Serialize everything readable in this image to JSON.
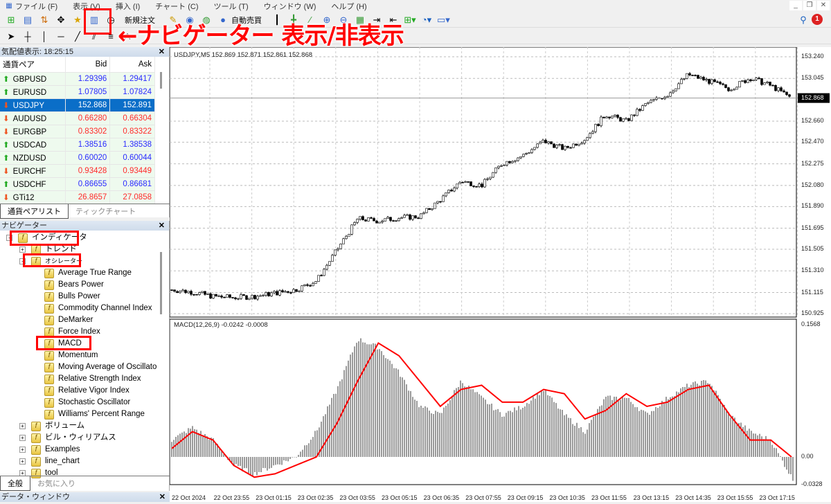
{
  "menu": [
    "ファイル (F)",
    "表示 (V)",
    "挿入 (I)",
    "チャート (C)",
    "ツール (T)",
    "ウィンドウ (W)",
    "ヘルプ (H)"
  ],
  "toolbar": {
    "new_order": "新規注文",
    "auto_trade": "自動売買",
    "notification_count": "1"
  },
  "annotation": {
    "text": "←ナビゲーター 表示/非表示",
    "color": "#ff0000"
  },
  "market_watch": {
    "title": "気配値表示: 18:25:15",
    "columns": [
      "通貨ペア",
      "Bid",
      "Ask"
    ],
    "rows": [
      {
        "symbol": "GBPUSD",
        "bid": "1.29396",
        "ask": "1.29417",
        "dir": "up"
      },
      {
        "symbol": "EURUSD",
        "bid": "1.07805",
        "ask": "1.07824",
        "dir": "up"
      },
      {
        "symbol": "USDJPY",
        "bid": "152.868",
        "ask": "152.891",
        "dir": "down",
        "selected": true
      },
      {
        "symbol": "AUDUSD",
        "bid": "0.66280",
        "ask": "0.66304",
        "dir": "down"
      },
      {
        "symbol": "EURGBP",
        "bid": "0.83302",
        "ask": "0.83322",
        "dir": "down"
      },
      {
        "symbol": "USDCAD",
        "bid": "1.38516",
        "ask": "1.38538",
        "dir": "up"
      },
      {
        "symbol": "NZDUSD",
        "bid": "0.60020",
        "ask": "0.60044",
        "dir": "up"
      },
      {
        "symbol": "EURCHF",
        "bid": "0.93428",
        "ask": "0.93449",
        "dir": "down"
      },
      {
        "symbol": "USDCHF",
        "bid": "0.86655",
        "ask": "0.86681",
        "dir": "up"
      },
      {
        "symbol": "GTi12",
        "bid": "26.8657",
        "ask": "27.0858",
        "dir": "down"
      }
    ],
    "tabs": [
      "通貨ペアリスト",
      "ティックチャート"
    ]
  },
  "navigator": {
    "title": "ナビゲーター",
    "root": "インディケータ",
    "groups": [
      "トレンド",
      "オシレーター"
    ],
    "oscillators": [
      "Average True Range",
      "Bears Power",
      "Bulls Power",
      "Commodity Channel Index",
      "DeMarker",
      "Force Index",
      "MACD",
      "Momentum",
      "Moving Average of Oscillato",
      "Relative Strength Index",
      "Relative Vigor Index",
      "Stochastic Oscillator",
      "Williams' Percent Range"
    ],
    "others": [
      "ボリューム",
      "ビル・ウィリアムス",
      "Examples",
      "line_chart",
      "tool"
    ],
    "tabs": [
      "全般",
      "お気に入り"
    ]
  },
  "data_window": {
    "title": "データ・ウィンドウ"
  },
  "chart_data": [
    {
      "type": "candlestick",
      "title": "USDJPY,M5  152.869 152.871 152.861 152.868",
      "ylim": [
        150.925,
        153.24
      ],
      "yticks": [
        "153.240",
        "153.045",
        "152.660",
        "152.470",
        "152.275",
        "152.080",
        "151.890",
        "151.695",
        "151.505",
        "151.310",
        "151.115",
        "150.925"
      ],
      "current_price": "152.868",
      "sample_times": [
        "22 Oct 22:35",
        "+40min steps to 23 Oct 18:15"
      ],
      "close_samples": [
        151.14,
        151.12,
        151.08,
        151.07,
        151.08,
        151.11,
        151.14,
        151.22,
        151.5,
        151.78,
        151.76,
        151.79,
        151.8,
        151.95,
        152.12,
        152.08,
        152.28,
        152.35,
        152.48,
        152.41,
        152.5,
        152.72,
        152.66,
        152.82,
        152.9,
        153.08,
        153.02,
        152.95,
        153.05,
        152.98,
        152.868
      ]
    },
    {
      "type": "macd",
      "title": "MACD(12,26,9) -0.0242 -0.0008",
      "ylim": [
        -0.0328,
        0.1568
      ],
      "yticks": [
        "0.1568",
        "0.00",
        "-0.0328"
      ],
      "main_samples": [
        0.02,
        0.035,
        0.02,
        -0.01,
        -0.02,
        -0.01,
        0.0,
        0.03,
        0.08,
        0.14,
        0.13,
        0.1,
        0.06,
        0.05,
        0.09,
        0.07,
        0.05,
        0.06,
        0.08,
        0.05,
        0.03,
        0.07,
        0.07,
        0.05,
        0.07,
        0.085,
        0.09,
        0.05,
        0.03,
        0.02,
        -0.024
      ],
      "signal_samples": [
        0.01,
        0.03,
        0.02,
        -0.01,
        -0.024,
        -0.02,
        -0.01,
        0.0,
        0.04,
        0.09,
        0.135,
        0.12,
        0.09,
        0.06,
        0.08,
        0.085,
        0.065,
        0.065,
        0.08,
        0.075,
        0.045,
        0.055,
        0.075,
        0.06,
        0.065,
        0.08,
        0.085,
        0.05,
        0.02,
        0.02,
        0.0
      ],
      "signal_color": "#ff0000"
    },
    {
      "type": "time_axis",
      "labels": [
        "22 Oct 2024",
        "22 Oct 23:55",
        "23 Oct 01:15",
        "23 Oct 02:35",
        "23 Oct 03:55",
        "23 Oct 05:15",
        "23 Oct 06:35",
        "23 Oct 07:55",
        "23 Oct 09:15",
        "23 Oct 10:35",
        "23 Oct 11:55",
        "23 Oct 13:15",
        "23 Oct 14:35",
        "23 Oct 15:55",
        "23 Oct 17:15"
      ]
    }
  ]
}
